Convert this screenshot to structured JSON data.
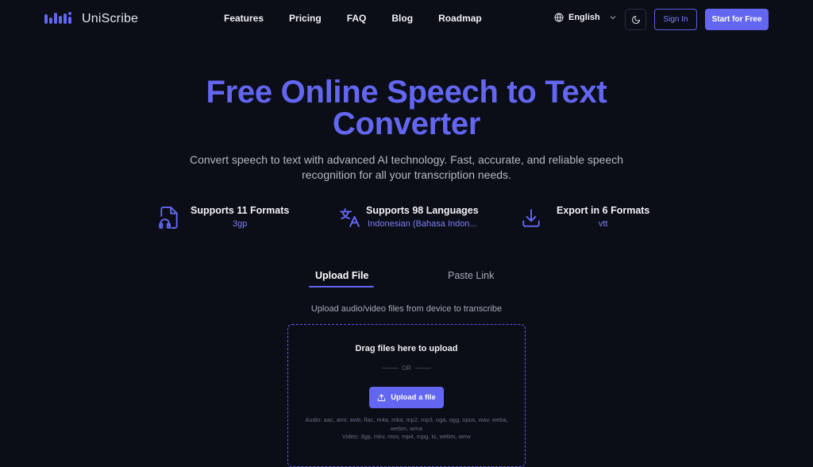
{
  "brand": {
    "name": "UniScribe"
  },
  "nav": {
    "links": [
      "Features",
      "Pricing",
      "FAQ",
      "Blog",
      "Roadmap"
    ],
    "language": "English",
    "sign_in": "Sign In",
    "start": "Start for Free"
  },
  "hero": {
    "title": "Free Online Speech to Text Converter",
    "subtitle": "Convert speech to text with advanced AI technology. Fast, accurate, and reliable speech recognition for all your transcription needs."
  },
  "features": [
    {
      "title": "Supports 11 Formats",
      "value": "3gp",
      "icon": "file-audio-icon"
    },
    {
      "title": "Supports 98 Languages",
      "value": "Indonesian (Bahasa Indon...",
      "icon": "translate-icon"
    },
    {
      "title": "Export in 6 Formats",
      "value": "vtt",
      "icon": "download-icon"
    }
  ],
  "tabs": {
    "upload": "Upload File",
    "link": "Paste Link"
  },
  "upload": {
    "description": "Upload audio/video files from device to transcribe",
    "drag": "Drag files here to upload",
    "or": "OR",
    "button": "Upload a file",
    "audio_formats": "Audio: aac, amr, awb, flac, m4a, mka, mp2, mp3, oga, ogg, opus, wav, weba, webm, wma",
    "video_formats": "Video: 3gp, mkv, mov, mp4, mpg, ts, webm, wmv"
  },
  "colors": {
    "accent": "#6366f1",
    "background": "#0b0d17"
  }
}
